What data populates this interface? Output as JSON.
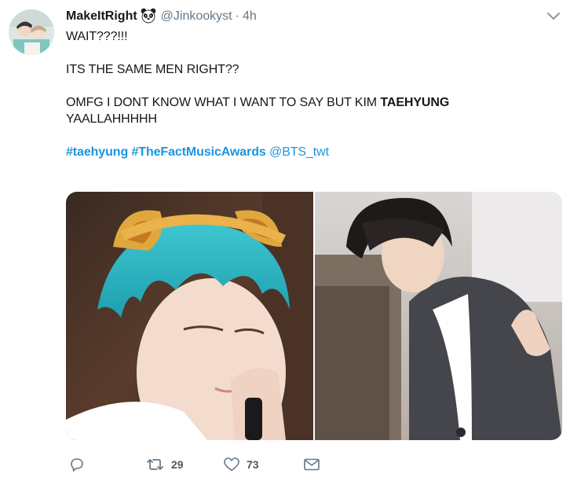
{
  "header": {
    "display_name": "MakeItRight",
    "handle": "@Jinkookyst",
    "separator": "·",
    "time": "4h"
  },
  "tweet": {
    "line1": "WAIT???!!!",
    "line2": "ITS THE SAME MEN RIGHT??",
    "line3_prefix": "OMFG I DONT KNOW WHAT I WANT TO SAY BUT KIM ",
    "line3_bold": "TAEHYUNG",
    "line4": "YAALLAHHHHH",
    "hashtag1": "#taehyung",
    "hashtag2": "#TheFactMusicAwards",
    "mention": "@BTS_twt"
  },
  "actions": {
    "retweet_count": "29",
    "like_count": "73"
  },
  "icons": {
    "name_emoji": "panda-icon",
    "reply": "reply-icon",
    "retweet": "retweet-icon",
    "like": "heart-icon",
    "dm": "envelope-icon",
    "caret": "chevron-down-icon"
  },
  "colors": {
    "link": "#1b95e0",
    "text": "#14171a",
    "secondary": "#657786",
    "action_icon": "#657786"
  }
}
